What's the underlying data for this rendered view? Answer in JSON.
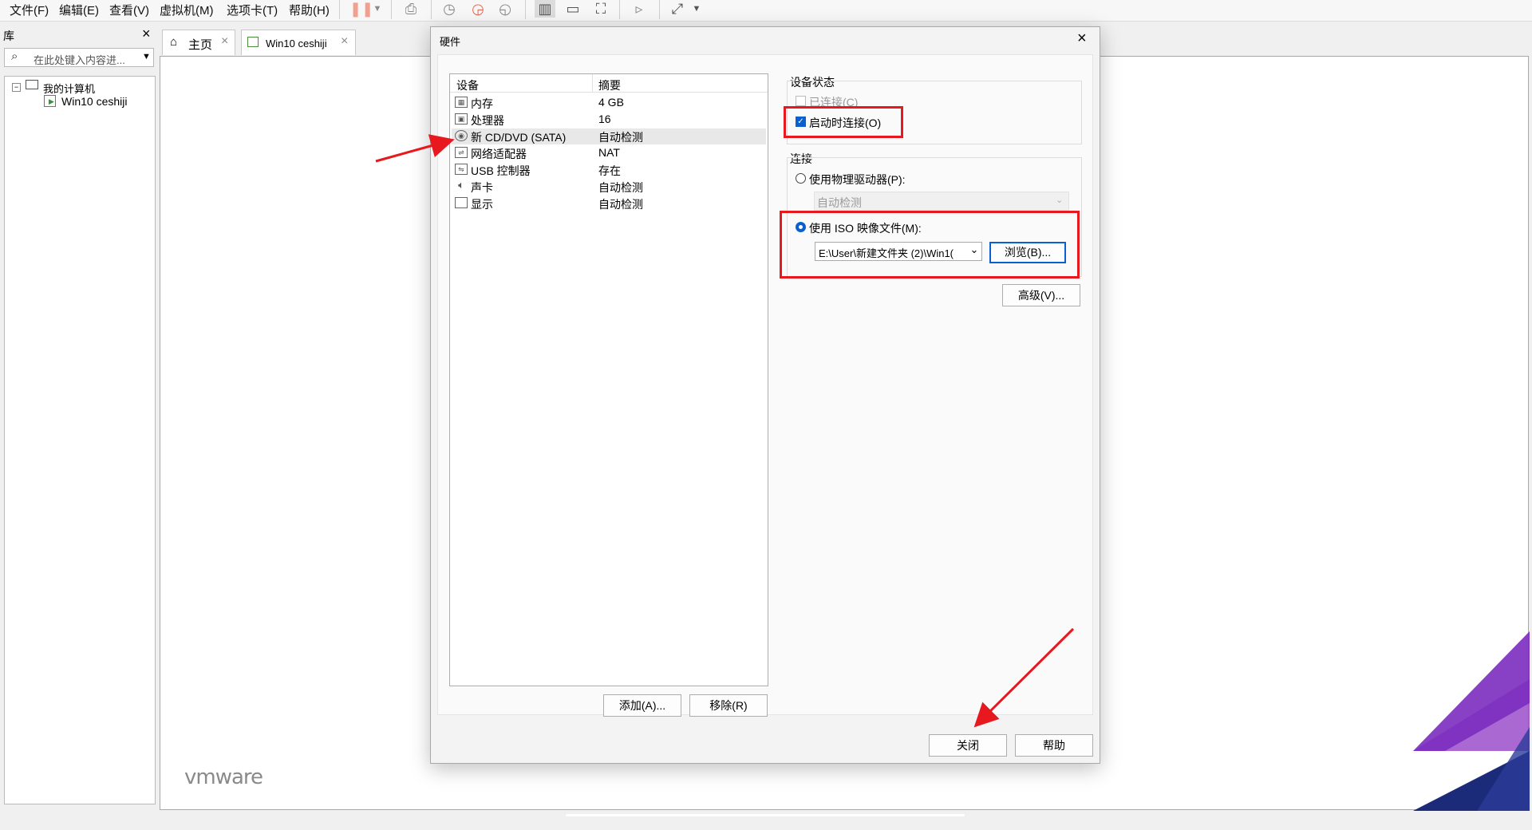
{
  "menu": {
    "items": [
      "文件(F)",
      "编辑(E)",
      "查看(V)",
      "虚拟机(M)",
      "选项卡(T)",
      "帮助(H)"
    ]
  },
  "toolbar_icons": [
    "pause-icon",
    "dropdown-icon",
    "send-keys-icon",
    "snapshot-icon",
    "revert-snapshot-icon",
    "snapshot-manager-icon",
    "view-normal-icon",
    "view-console-icon",
    "fullscreen-icon",
    "terminal-icon",
    "stretch-icon"
  ],
  "library": {
    "title": "库",
    "close": "×",
    "search_placeholder": "在此处键入内容进...",
    "tree": {
      "root": "我的计算机",
      "children": [
        "Win10 ceshiji"
      ]
    }
  },
  "tabs": [
    {
      "label": "主页",
      "close": "×"
    },
    {
      "label": "Win10 ceshiji",
      "close": "×"
    }
  ],
  "brand": "vmware",
  "dialog": {
    "title": "硬件",
    "close": "×",
    "list_headers": {
      "device": "设备",
      "summary": "摘要"
    },
    "devices": [
      {
        "name": "内存",
        "summary": "4 GB",
        "icon": "memory-icon"
      },
      {
        "name": "处理器",
        "summary": "16",
        "icon": "cpu-icon"
      },
      {
        "name": "新 CD/DVD (SATA)",
        "summary": "自动检测",
        "icon": "cd-dvd-icon",
        "selected": true
      },
      {
        "name": "网络适配器",
        "summary": "NAT",
        "icon": "network-icon"
      },
      {
        "name": "USB 控制器",
        "summary": "存在",
        "icon": "usb-icon"
      },
      {
        "name": "声卡",
        "summary": "自动检测",
        "icon": "sound-icon"
      },
      {
        "name": "显示",
        "summary": "自动检测",
        "icon": "display-icon"
      }
    ],
    "add_button": "添加(A)...",
    "remove_button": "移除(R)",
    "device_status": {
      "title": "设备状态",
      "connected": {
        "label": "已连接(C)",
        "checked": false,
        "disabled": true
      },
      "connect_at_power_on": {
        "label": "启动时连接(O)",
        "checked": true
      }
    },
    "connection": {
      "title": "连接",
      "physical": {
        "label": "使用物理驱动器(P):",
        "selected": false
      },
      "physical_value": "自动检测",
      "iso": {
        "label": "使用 ISO 映像文件(M):",
        "selected": true
      },
      "iso_path": "E:\\User\\新建文件夹 (2)\\Win1(",
      "browse_button": "浏览(B)...",
      "advanced_button": "高级(V)..."
    },
    "close_button": "关闭",
    "help_button": "帮助"
  },
  "colors": {
    "annotation_red": "#e8181f",
    "accent_blue": "#0a5fd1",
    "brand_purple": "#7b2cbf",
    "brand_navy": "#1c2a7a"
  }
}
